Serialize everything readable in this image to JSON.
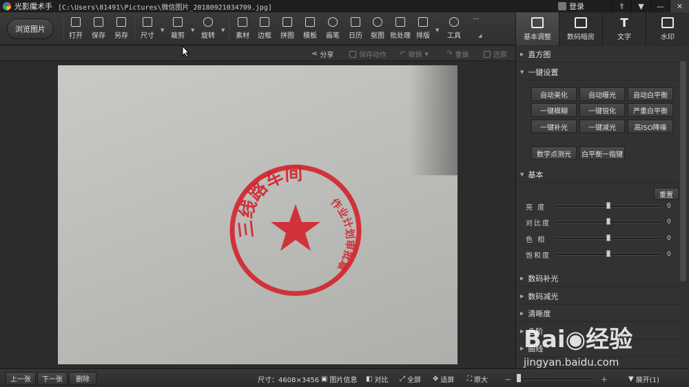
{
  "titlebar": {
    "app_name": "光影魔术手",
    "path": "[C:\\Users\\81491\\Pictures\\微信图片_20180921034709.jpg]",
    "login_label": "登录",
    "window_buttons": [
      "pin-icon",
      "restore-icon",
      "minimize-icon",
      "close-icon"
    ]
  },
  "toolbar": {
    "browse_label": "浏览图片",
    "tools": [
      {
        "label": "打开",
        "icon": "open-icon"
      },
      {
        "label": "保存",
        "icon": "save-icon"
      },
      {
        "label": "另存",
        "icon": "save-as-icon"
      },
      {
        "label": "尺寸",
        "icon": "resize-icon"
      },
      {
        "label": "裁剪",
        "icon": "crop-icon"
      },
      {
        "label": "旋转",
        "icon": "rotate-icon"
      },
      {
        "label": "素材",
        "icon": "material-icon"
      },
      {
        "label": "边框",
        "icon": "border-icon"
      },
      {
        "label": "拼图",
        "icon": "collage-icon"
      },
      {
        "label": "模板",
        "icon": "template-icon"
      },
      {
        "label": "画笔",
        "icon": "brush-icon"
      },
      {
        "label": "日历",
        "icon": "calendar-icon"
      },
      {
        "label": "抠图",
        "icon": "cutout-icon"
      },
      {
        "label": "批处理",
        "icon": "batch-icon"
      },
      {
        "label": "排版",
        "icon": "layout-icon"
      },
      {
        "label": "工具",
        "icon": "tools-icon"
      },
      {
        "label": "···",
        "icon": "more-icon"
      }
    ]
  },
  "right_tabs": [
    {
      "label": "基本调整",
      "active": true
    },
    {
      "label": "数码暗房",
      "active": false
    },
    {
      "label": "文字",
      "glyph": "T",
      "active": false
    },
    {
      "label": "水印",
      "active": false
    }
  ],
  "actionbar": {
    "share": "分享",
    "save_action": "保存动作",
    "undo": "撤销",
    "redo": "重做",
    "restore": "还原"
  },
  "panel": {
    "histogram": "直方图",
    "one_key": "一键设置",
    "one_key_buttons": [
      "自动美化",
      "自动曝光",
      "自动白平衡",
      "一键模糊",
      "一键锐化",
      "严重白平衡",
      "一键补光",
      "一键减光",
      "高ISO降噪"
    ],
    "extra_buttons": [
      "数字点测光",
      "白平衡一指键"
    ],
    "basic": "基本",
    "reset": "重置",
    "sliders": [
      {
        "label": "亮 度",
        "value": "0"
      },
      {
        "label": "对比度",
        "value": "0"
      },
      {
        "label": "色 相",
        "value": "0"
      },
      {
        "label": "饱和度",
        "value": "0"
      }
    ],
    "sections": [
      "数码补光",
      "数码减光",
      "清晰度",
      "色阶",
      "曲线"
    ]
  },
  "stamp": {
    "top_text": "三线路车间",
    "bottom_text": "作业计划审批章",
    "color": "#d3242c"
  },
  "statusbar": {
    "prev": "上一张",
    "next": "下一张",
    "delete": "删除",
    "size": "尺寸：4608×3456",
    "info": "图片信息",
    "compare": "对比",
    "fullscreen": "全屏",
    "fit": "适屏",
    "original": "原大",
    "zoom_minus": "－",
    "zoom_plus": "＋",
    "expand": "展开(1)"
  },
  "watermark": {
    "brand": "Bai◉经验",
    "url": "jingyan.baidu.com"
  }
}
